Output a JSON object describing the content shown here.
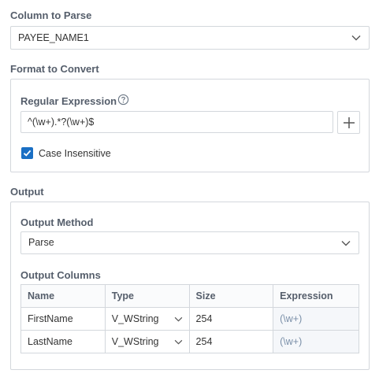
{
  "column_to_parse": {
    "label": "Column to Parse",
    "value": "PAYEE_NAME1"
  },
  "format_to_convert": {
    "label": "Format to Convert",
    "regex_label": "Regular Expression",
    "regex_value": "^(\\w+).*?(\\w+)$",
    "case_insensitive_label": "Case Insensitive",
    "case_insensitive_checked": true
  },
  "output": {
    "label": "Output",
    "method_label": "Output Method",
    "method_value": "Parse",
    "columns_label": "Output Columns",
    "columns_headers": [
      "Name",
      "Type",
      "Size",
      "Expression"
    ],
    "rows": [
      {
        "name": "FirstName",
        "type": "V_WString",
        "size": "254",
        "expression": "(\\w+)"
      },
      {
        "name": "LastName",
        "type": "V_WString",
        "size": "254",
        "expression": "(\\w+)"
      }
    ]
  },
  "colors": {
    "accent": "#1a6fc4",
    "border": "#d3d7dc",
    "label": "#555e6b"
  }
}
